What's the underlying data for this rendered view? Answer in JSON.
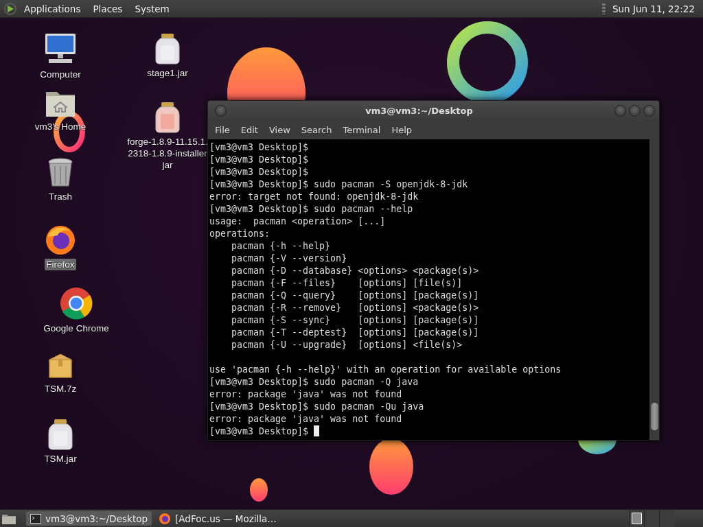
{
  "top_panel": {
    "menus": [
      "Applications",
      "Places",
      "System"
    ],
    "clock": "Sun Jun 11, 22:22"
  },
  "desktop_icons": [
    {
      "kind": "computer",
      "label": "Computer",
      "selected": false
    },
    {
      "kind": "home",
      "label": "vm3's Home",
      "selected": false
    },
    {
      "kind": "trash",
      "label": "Trash",
      "selected": false
    },
    {
      "kind": "firefox",
      "label": "Firefox",
      "selected": true
    },
    {
      "kind": "chrome",
      "label": "Google Chrome",
      "selected": false
    },
    {
      "kind": "archive",
      "label": "TSM.7z",
      "selected": false
    },
    {
      "kind": "jar",
      "label": "TSM.jar",
      "selected": false
    },
    {
      "kind": "jar",
      "label": "stage1.jar",
      "selected": false
    },
    {
      "kind": "jar-pink",
      "label": "forge-1.8.9-11.15.1.\n2318-1.8.9-installer\njar",
      "selected": false
    }
  ],
  "terminal": {
    "title": "vm3@vm3:~/Desktop",
    "menu": [
      "File",
      "Edit",
      "View",
      "Search",
      "Terminal",
      "Help"
    ],
    "lines": [
      {
        "kind": "text",
        "text": "[vm3@vm3 Desktop]$"
      },
      {
        "kind": "text",
        "text": "[vm3@vm3 Desktop]$"
      },
      {
        "kind": "text",
        "text": "[vm3@vm3 Desktop]$"
      },
      {
        "kind": "text",
        "text": "[vm3@vm3 Desktop]$ sudo pacman -S openjdk-8-jdk"
      },
      {
        "kind": "text",
        "text": "error: target not found: openjdk-8-jdk"
      },
      {
        "kind": "text",
        "text": "[vm3@vm3 Desktop]$ sudo pacman --help"
      },
      {
        "kind": "text",
        "text": "usage:  pacman <operation> [...]"
      },
      {
        "kind": "text",
        "text": "operations:"
      },
      {
        "kind": "text",
        "text": "    pacman {-h --help}"
      },
      {
        "kind": "text",
        "text": "    pacman {-V --version}"
      },
      {
        "kind": "text",
        "text": "    pacman {-D --database} <options> <package(s)>"
      },
      {
        "kind": "text",
        "text": "    pacman {-F --files}    [options] [file(s)]"
      },
      {
        "kind": "text",
        "text": "    pacman {-Q --query}    [options] [package(s)]"
      },
      {
        "kind": "text",
        "text": "    pacman {-R --remove}   [options] <package(s)>"
      },
      {
        "kind": "text",
        "text": "    pacman {-S --sync}     [options] [package(s)]"
      },
      {
        "kind": "text",
        "text": "    pacman {-T --deptest}  [options] [package(s)]"
      },
      {
        "kind": "text",
        "text": "    pacman {-U --upgrade}  [options] <file(s)>"
      },
      {
        "kind": "blank"
      },
      {
        "kind": "text",
        "text": "use 'pacman {-h --help}' with an operation for available options"
      },
      {
        "kind": "text",
        "text": "[vm3@vm3 Desktop]$ sudo pacman -Q java"
      },
      {
        "kind": "text",
        "text": "error: package 'java' was not found"
      },
      {
        "kind": "text",
        "text": "[vm3@vm3 Desktop]$ sudo pacman -Qu java"
      },
      {
        "kind": "text",
        "text": "error: package 'java' was not found"
      }
    ],
    "prompt": "[vm3@vm3 Desktop]$ "
  },
  "taskbar": {
    "tasks": [
      {
        "kind": "terminal",
        "label": "vm3@vm3:~/Desktop",
        "selected": true
      },
      {
        "kind": "firefox",
        "label": "[AdFoc.us — Mozilla…",
        "selected": false
      }
    ],
    "workspaces": [
      {
        "selected": true
      },
      {
        "selected": false
      },
      {
        "selected": false
      }
    ]
  }
}
